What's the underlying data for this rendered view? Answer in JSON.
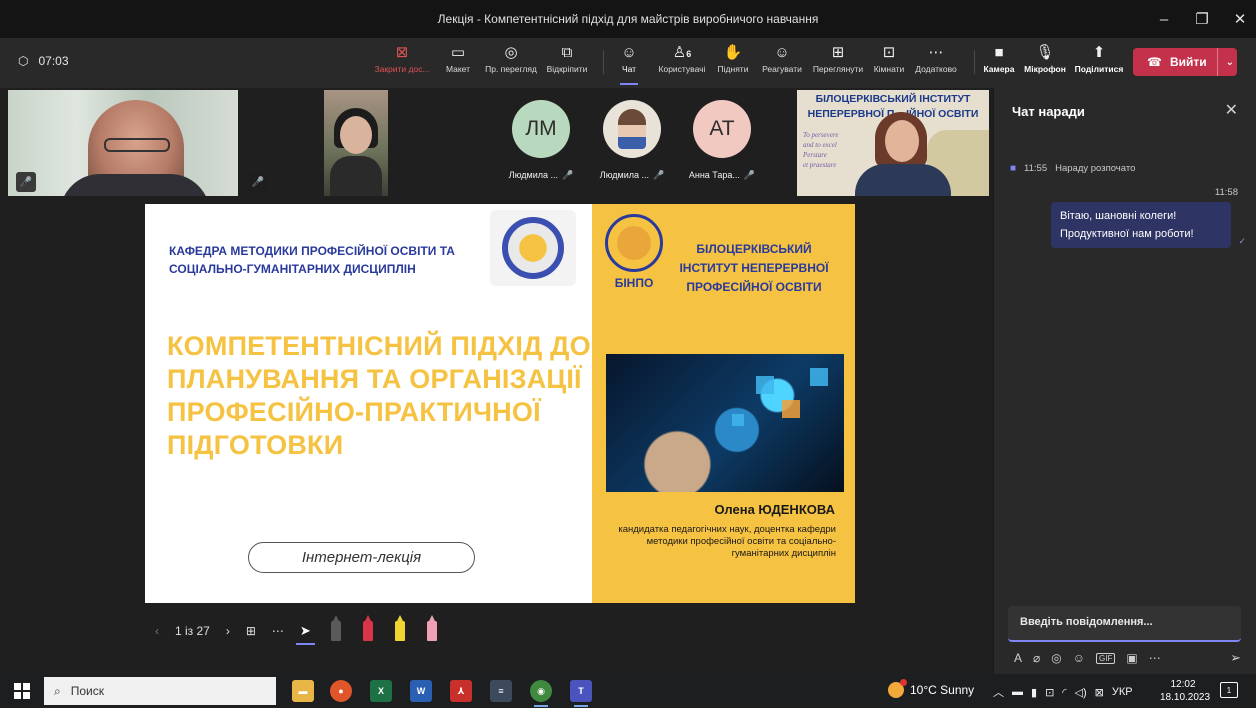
{
  "window": {
    "title": "Лекція - Компетентнісний підхід для майстрів виробничого навчання",
    "controls": [
      "–",
      "❐",
      "✕"
    ]
  },
  "toolbar": {
    "timer": "07:03",
    "items": [
      {
        "label": "Закрити дос...",
        "icon": "close-box-icon"
      },
      {
        "label": "Макет",
        "icon": "layout-icon"
      },
      {
        "label": "Пр. перегляд",
        "icon": "eye-icon"
      },
      {
        "label": "Відкріпити",
        "icon": "pop-out-icon"
      },
      {
        "label": "Чат",
        "icon": "chat-icon"
      },
      {
        "label": "Користувачі",
        "icon": "people-icon",
        "badge": "6"
      },
      {
        "label": "Підняти",
        "icon": "raise-hand-icon"
      },
      {
        "label": "Реагувати",
        "icon": "smile-icon"
      },
      {
        "label": "Переглянути",
        "icon": "view-icon"
      },
      {
        "label": "Кімнати",
        "icon": "rooms-icon"
      },
      {
        "label": "Додатково",
        "icon": "more-icon"
      },
      {
        "label": "Камера",
        "icon": "camera-icon"
      },
      {
        "label": "Мікрофон",
        "icon": "mic-icon"
      },
      {
        "label": "Поділитися",
        "icon": "share-icon"
      }
    ],
    "leave_label": "Вийти"
  },
  "participants": {
    "avatars": [
      {
        "initials": "ЛМ",
        "name": "Людмила ..."
      },
      {
        "initials": "",
        "name": "Людмила ..."
      },
      {
        "initials": "АТ",
        "name": "Анна Тара..."
      }
    ],
    "tile6_banner": "БІЛОЦЕРКІВСЬКИЙ ІНСТИТУТ НЕПЕРЕРВНОЇ П... ІЙНОЇ ОСВІТИ",
    "tile6_motto": [
      "To persevere",
      "and to excel",
      "Perstare",
      "et praestare"
    ]
  },
  "slide": {
    "department": "КАФЕДРА МЕТОДИКИ ПРОФЕСІЙНОЇ ОСВІТИ ТА СОЦІАЛЬНО-ГУМАНІТАРНИХ ДИСЦИПЛІН",
    "institute_abbr": "БІНПО",
    "institute_name": "БІЛОЦЕРКІВСЬКИЙ ІНСТИТУТ НЕПЕРЕРВНОЇ ПРОФЕСІЙНОЇ ОСВІТИ",
    "title": "КОМПЕТЕНТНІСНИЙ ПІДХІД ДО  ПЛАНУВАННЯ ТА ОРГАНІЗАЦІЇ ПРОФЕСІЙНО-ПРАКТИЧНОЇ ПІДГОТОВКИ",
    "author": "Олена ЮДЕНКОВА",
    "author_desc": "кандидатка педагогічних наук, доцентка кафедри методики професійної освіти та соціально-гуманітарних дисциплін",
    "lecture_type": "Інтернет-лекція"
  },
  "presenter": {
    "page_indicator": "1 із 27"
  },
  "chat": {
    "title": "Чат наради",
    "system_time": "11:55",
    "system_text": "Нараду розпочато",
    "message_time": "11:58",
    "message_text": "Вітаю, шановні колеги! Продуктивної нам роботи!",
    "compose_placeholder": "Введіть повідомлення..."
  },
  "taskbar": {
    "search_placeholder": "Поиск",
    "weather": "10°C  Sunny",
    "language": "УКР",
    "time": "12:02",
    "date": "18.10.2023",
    "notifications": "1"
  },
  "colors": {
    "accent": "#7f85f5",
    "leave": "#c4314b",
    "slide_yellow": "#f5c242",
    "slide_blue": "#2a3a9c"
  }
}
